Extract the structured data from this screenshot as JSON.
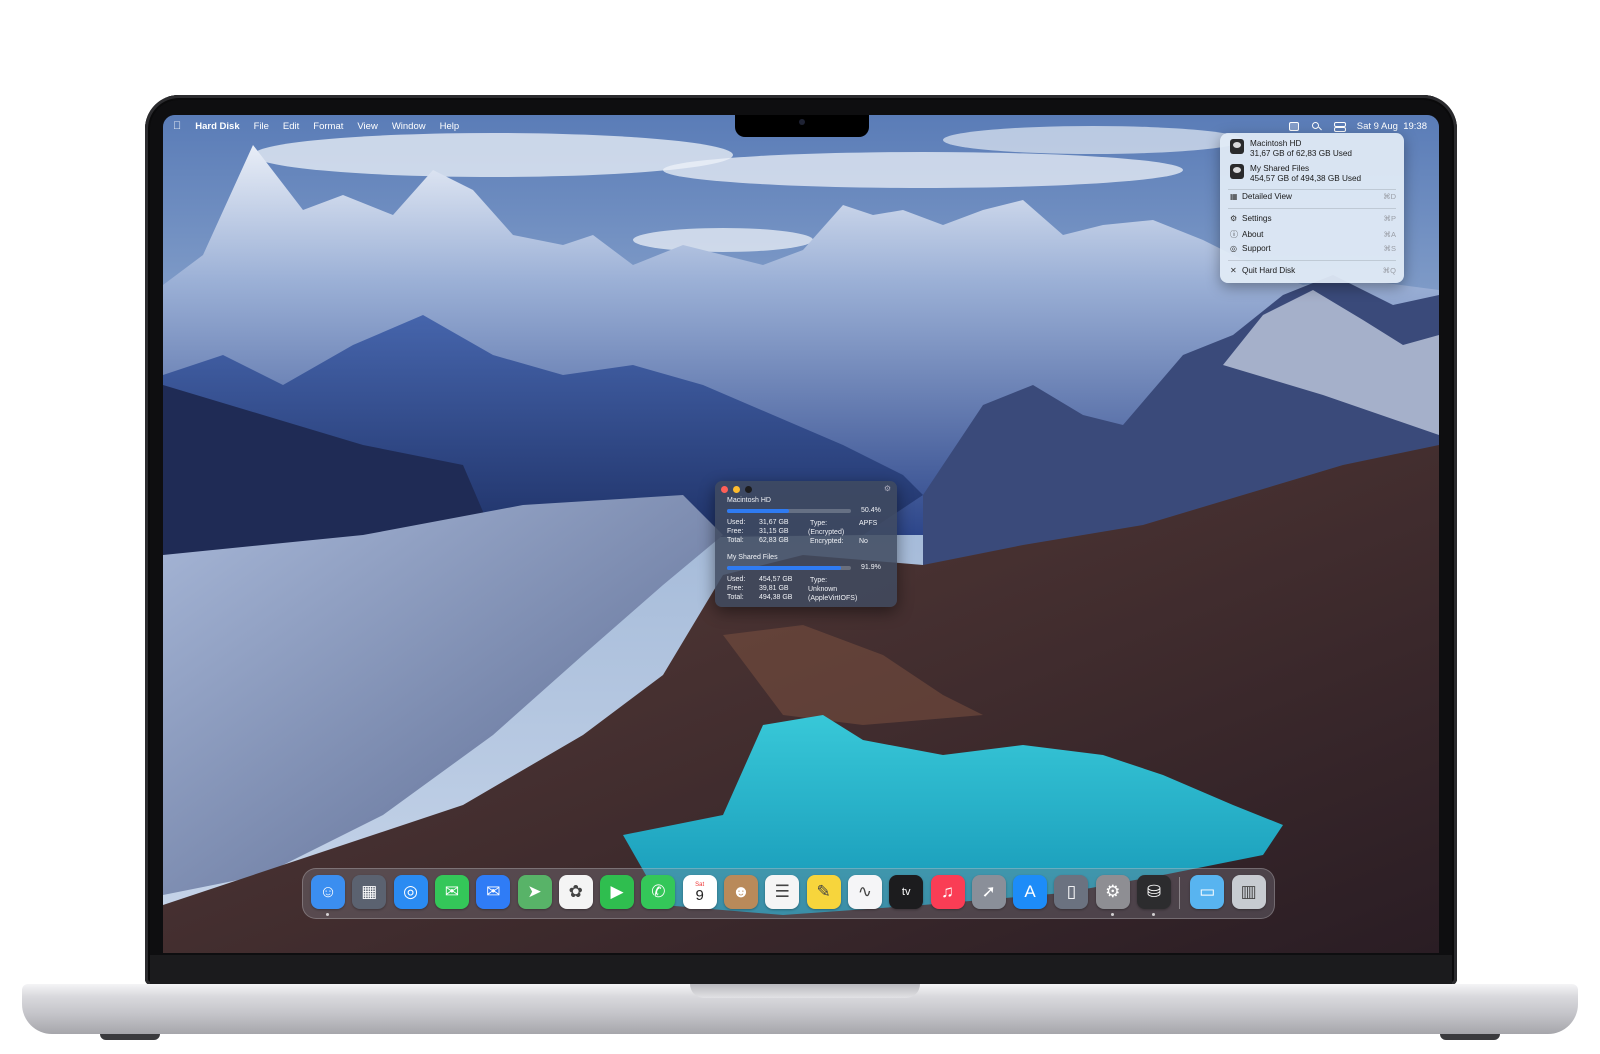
{
  "menubar": {
    "app_name": "Hard Disk",
    "menus": [
      "File",
      "Edit",
      "Format",
      "View",
      "Window",
      "Help"
    ],
    "clock": "Sat 9 Aug  19:38"
  },
  "dropdown": {
    "disks": [
      {
        "name": "Macintosh HD",
        "usage": "31,67 GB of 62,83 GB Used"
      },
      {
        "name": "My Shared Files",
        "usage": "454,57 GB of 494,38 GB Used"
      }
    ],
    "items": [
      {
        "label": "Detailed View",
        "shortcut": "⌘D",
        "icon": "detailed-view-icon"
      },
      {
        "label": "Settings",
        "shortcut": "⌘P",
        "icon": "gear-icon"
      },
      {
        "label": "About",
        "shortcut": "⌘A",
        "icon": "info-icon"
      },
      {
        "label": "Support",
        "shortcut": "⌘S",
        "icon": "support-icon"
      },
      {
        "label": "Quit Hard Disk",
        "shortcut": "⌘Q",
        "icon": "close-icon"
      }
    ]
  },
  "info_window": {
    "disks": [
      {
        "name": "Macintosh HD",
        "percent": "50.4%",
        "fraction": 0.504,
        "used_label": "Used:",
        "used": "31,67 GB",
        "free_label": "Free:",
        "free": "31,15 GB",
        "total_label": "Total:",
        "total": "62,83 GB",
        "type_label": "Type:",
        "type": "APFS",
        "type_note": "(Encrypted)",
        "encrypted_label": "Encrypted:",
        "encrypted": "No"
      },
      {
        "name": "My Shared Files",
        "percent": "91.9%",
        "fraction": 0.919,
        "used_label": "Used:",
        "used": "454,57 GB",
        "free_label": "Free:",
        "free": "39,81 GB",
        "total_label": "Total:",
        "total": "494,38 GB",
        "type_label": "Type:",
        "type": "Unknown",
        "type_note": "(AppleVirtIOFS)"
      }
    ]
  },
  "dock": {
    "calendar_month": "Sat",
    "calendar_day": "9",
    "apps": [
      {
        "name": "finder",
        "color": "#3b8ef0"
      },
      {
        "name": "launchpad",
        "color": "#5b6270"
      },
      {
        "name": "safari",
        "color": "#2a8bf2"
      },
      {
        "name": "messages",
        "color": "#34c759"
      },
      {
        "name": "mail",
        "color": "#2f7cf6"
      },
      {
        "name": "maps",
        "color": "#58b368"
      },
      {
        "name": "photos",
        "color": "#f4f4f4"
      },
      {
        "name": "facetime",
        "color": "#2fbe4f"
      },
      {
        "name": "phone",
        "color": "#34c759"
      },
      {
        "name": "calendar",
        "color": "#ffffff"
      },
      {
        "name": "contacts",
        "color": "#b98a5a"
      },
      {
        "name": "reminders",
        "color": "#f5f5f5"
      },
      {
        "name": "notes",
        "color": "#f7d53c"
      },
      {
        "name": "freeform",
        "color": "#f5f5f7"
      },
      {
        "name": "tv",
        "color": "#1c1c1e"
      },
      {
        "name": "music",
        "color": "#fa3d55"
      },
      {
        "name": "rocket",
        "color": "#8a8f99"
      },
      {
        "name": "app-store",
        "color": "#1d8cf8"
      },
      {
        "name": "iphone-mirroring",
        "color": "#6b7280"
      },
      {
        "name": "system-settings",
        "color": "#8e8e93"
      },
      {
        "name": "hard-disk",
        "color": "#2c2c2e"
      },
      {
        "name": "downloads-folder",
        "color": "#58b4f0"
      },
      {
        "name": "trash",
        "color": "#c7cbd1"
      }
    ]
  }
}
